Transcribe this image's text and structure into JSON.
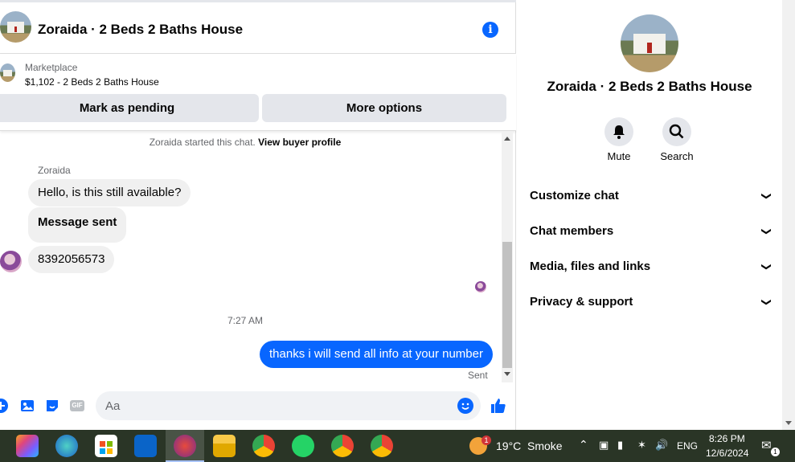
{
  "header": {
    "title": "Zoraida · 2 Beds 2 Baths House"
  },
  "marketplace": {
    "label": "Marketplace",
    "item": "$1,102 - 2 Beds 2 Baths House",
    "pending_label": "Mark as pending",
    "options_label": "More options"
  },
  "messages": {
    "system_text": "Zoraida started this chat.",
    "system_link": "View buyer profile",
    "sender": "Zoraida",
    "incoming": [
      "Hello, is this still available?",
      "Message sent",
      "8392056573"
    ],
    "timestamp": "7:27 AM",
    "outgoing": "thanks i will send all info at your number",
    "status": "Sent"
  },
  "composer": {
    "placeholder": "Aa",
    "gif_label": "GIF"
  },
  "panel": {
    "title": "Zoraida · 2 Beds 2 Baths House",
    "mute_label": "Mute",
    "search_label": "Search",
    "sections": [
      "Customize chat",
      "Chat members",
      "Media, files and links",
      "Privacy & support"
    ]
  },
  "taskbar": {
    "weather_temp": "19°C",
    "weather_text": "Smoke",
    "weather_badge": "1",
    "language": "ENG",
    "time": "8:26 PM",
    "date": "12/6/2024",
    "notification_count": "1"
  },
  "colors": {
    "accent": "#0866ff",
    "bubble_in": "#f0f0f0",
    "taskbar": "#2a3526"
  }
}
